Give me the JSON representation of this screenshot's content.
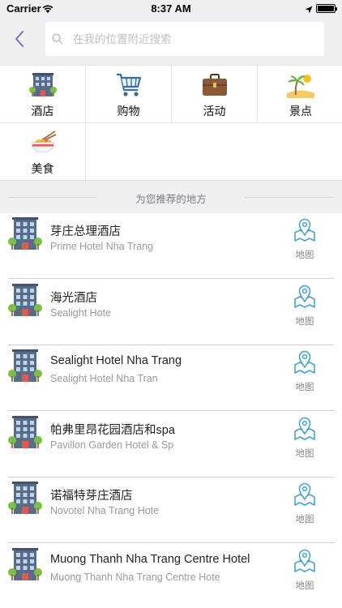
{
  "status_bar": {
    "carrier": "Carrier",
    "time": "8:37 AM"
  },
  "search": {
    "placeholder": "在我的位置附近搜索"
  },
  "categories": [
    {
      "label": "酒店",
      "icon": "hotel-icon"
    },
    {
      "label": "购物",
      "icon": "shopping-cart-icon"
    },
    {
      "label": "活动",
      "icon": "briefcase-icon"
    },
    {
      "label": "景点",
      "icon": "beach-icon"
    },
    {
      "label": "美食",
      "icon": "noodle-bowl-icon"
    }
  ],
  "section_title": "为您推荐的地方",
  "map_label": "地图",
  "hotels": [
    {
      "name": "芽庄总理酒店",
      "subtitle": "Prime Hotel Nha Trang"
    },
    {
      "name": "海光酒店",
      "subtitle": "Sealight Hote"
    },
    {
      "name": "Sealight Hotel Nha Trang",
      "subtitle": "Sealight Hotel Nha Tran"
    },
    {
      "name": "帕弗里昂花园酒店和spa",
      "subtitle": "Pavillon Garden Hotel & Sp"
    },
    {
      "name": "诺福特芽庄酒店",
      "subtitle": "Novotel Nha Trang Hote"
    },
    {
      "name": "Muong Thanh Nha Trang Centre Hotel",
      "subtitle": "Muong Thanh Nha Trang Centre Hote"
    }
  ],
  "colors": {
    "accent": "#4aa3c8",
    "nav_background": "#efeff4",
    "back_chevron": "#7a6fb0"
  }
}
